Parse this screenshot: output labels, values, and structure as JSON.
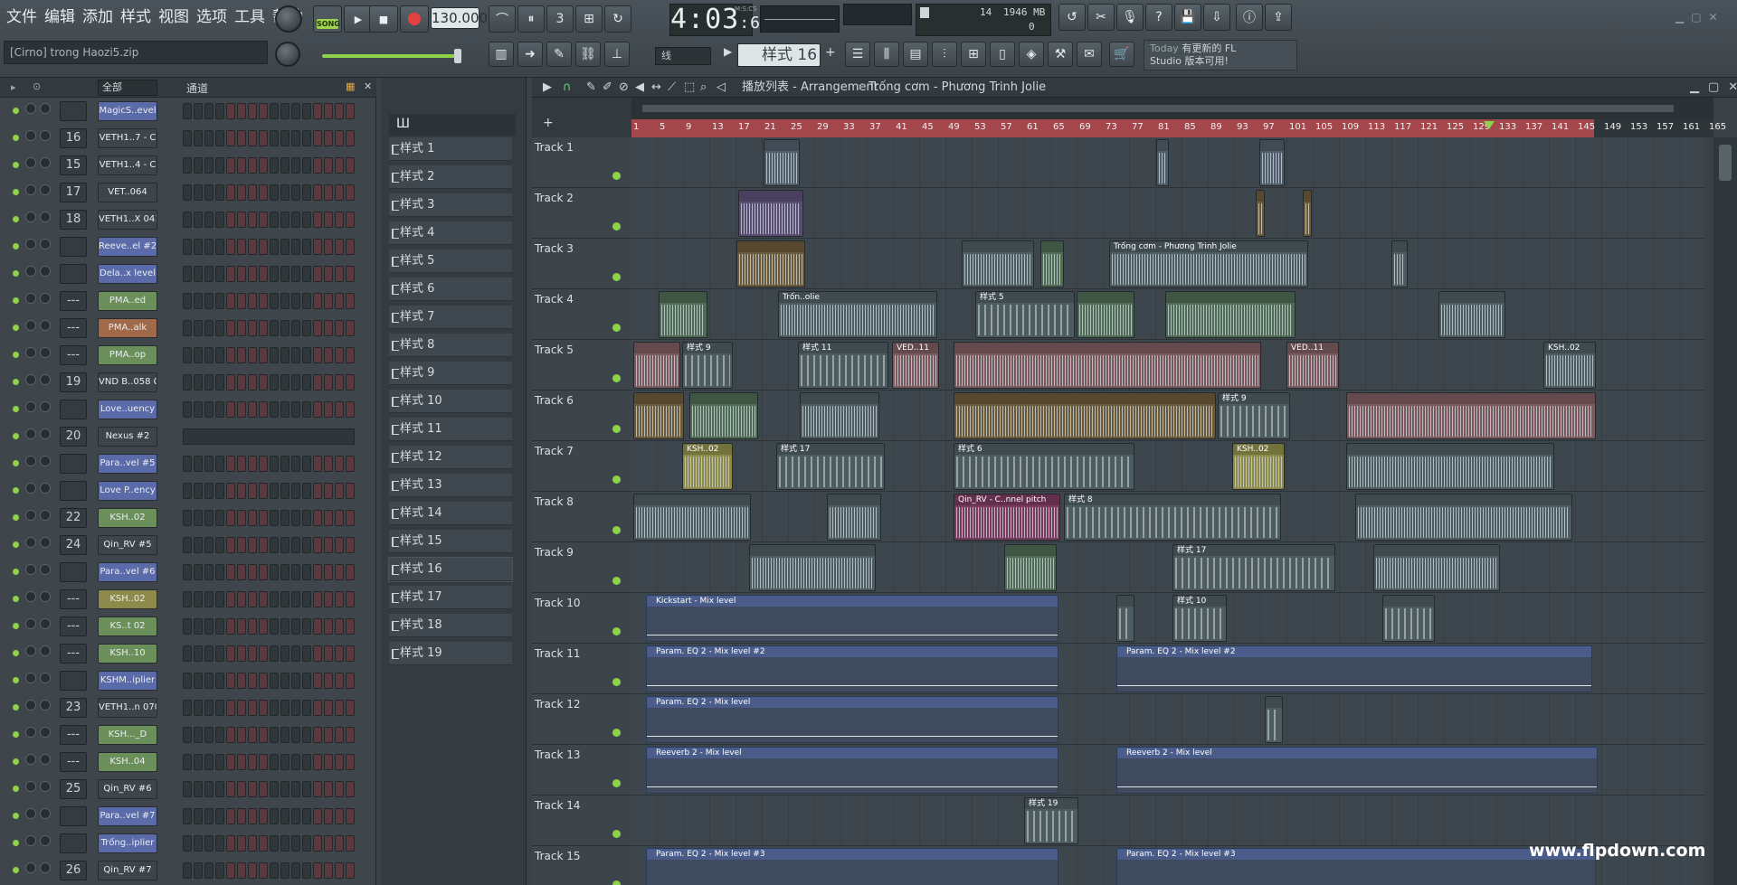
{
  "menu": [
    "文件",
    "编辑",
    "添加",
    "样式",
    "视图",
    "选项",
    "工具",
    "帮助"
  ],
  "hint_text": "[Cirno] trong Haozi5.zip",
  "song_label": "SONG",
  "tempo": "130.000",
  "clock": {
    "time": "4:03",
    "sub": ":69",
    "unit": "M:S:CS"
  },
  "cpu": {
    "value": "14",
    "memory": "1946 MB",
    "voices": "0"
  },
  "snap": "线",
  "pattern_selector": "样式 16",
  "news": {
    "day": "Today",
    "line1": "有更新的 FL",
    "line2": "Studio 版本可用!"
  },
  "rack": {
    "filter": "全部",
    "group": "通道"
  },
  "channels": [
    {
      "num": "",
      "name": "MagicS..evel",
      "color": "#5b6aa8"
    },
    {
      "num": "16",
      "name": "VETH1..7 - C",
      "color": "#3d454b"
    },
    {
      "num": "15",
      "name": "VETH1..4 - C",
      "color": "#3d454b"
    },
    {
      "num": "17",
      "name": "VET..064",
      "color": "#3d454b"
    },
    {
      "num": "18",
      "name": "VETH1..X 041",
      "color": "#3d454b"
    },
    {
      "num": "",
      "name": "Reeve..el #2",
      "color": "#5b6aa8"
    },
    {
      "num": "",
      "name": "Dela..x level",
      "color": "#5b6aa8"
    },
    {
      "num": "---",
      "name": "PMA..ed",
      "color": "#6a8f5a"
    },
    {
      "num": "---",
      "name": "PMA..alk",
      "color": "#a06a4a"
    },
    {
      "num": "---",
      "name": "PMA..op",
      "color": "#6a8f5a"
    },
    {
      "num": "19",
      "name": "VND B..058 C",
      "color": "#3d454b"
    },
    {
      "num": "",
      "name": "Love..uency",
      "color": "#5b6aa8"
    },
    {
      "num": "20",
      "name": "Nexus #2",
      "color": "#3d454b"
    },
    {
      "num": "",
      "name": "Para..vel #5",
      "color": "#5b6aa8"
    },
    {
      "num": "",
      "name": "Love P..ency",
      "color": "#5b6aa8"
    },
    {
      "num": "22",
      "name": "KSH..02",
      "color": "#6a8f5a"
    },
    {
      "num": "24",
      "name": "Qin_RV #5",
      "color": "#3d454b"
    },
    {
      "num": "",
      "name": "Para..vel #6",
      "color": "#5b6aa8"
    },
    {
      "num": "---",
      "name": "KSH..02",
      "color": "#8d8a4a"
    },
    {
      "num": "---",
      "name": "KS..t 02",
      "color": "#6a8f5a"
    },
    {
      "num": "---",
      "name": "KSH..10",
      "color": "#6a8f5a"
    },
    {
      "num": "",
      "name": "KSHM..iplier",
      "color": "#5b6aa8"
    },
    {
      "num": "23",
      "name": "VETH1..n 070",
      "color": "#3d454b"
    },
    {
      "num": "---",
      "name": "KSH..._D",
      "color": "#6a8f5a"
    },
    {
      "num": "---",
      "name": "KSH..04",
      "color": "#6a8f5a"
    },
    {
      "num": "25",
      "name": "Qin_RV #6",
      "color": "#3d454b"
    },
    {
      "num": "",
      "name": "Para..vel #7",
      "color": "#5b6aa8"
    },
    {
      "num": "",
      "name": "Trống..iplier",
      "color": "#5b6aa8"
    },
    {
      "num": "26",
      "name": "Qin_RV #7",
      "color": "#3d454b"
    }
  ],
  "patterns": [
    "样式 1",
    "样式 2",
    "样式 3",
    "样式 4",
    "样式 5",
    "样式 6",
    "样式 7",
    "样式 8",
    "样式 9",
    "样式 10",
    "样式 11",
    "样式 12",
    "样式 13",
    "样式 14",
    "样式 15",
    "样式 16",
    "样式 17",
    "样式 18",
    "样式 19"
  ],
  "playlist": {
    "title": "播放列表 - Arrangement",
    "crumb": "Trống cơm - Phương Trinh Jolie",
    "ruler": [
      "1",
      "5",
      "9",
      "13",
      "17",
      "21",
      "25",
      "29",
      "33",
      "37",
      "41",
      "45",
      "49",
      "53",
      "57",
      "61",
      "65",
      "69",
      "73",
      "77",
      "81",
      "85",
      "89",
      "93",
      "97",
      "101",
      "105",
      "109",
      "113",
      "117",
      "121",
      "125",
      "129",
      "133",
      "137",
      "141",
      "145",
      "149",
      "153",
      "157",
      "161",
      "165"
    ],
    "tracks": [
      "Track 1",
      "Track 2",
      "Track 3",
      "Track 4",
      "Track 5",
      "Track 6",
      "Track 7",
      "Track 8",
      "Track 9",
      "Track 10",
      "Track 11",
      "Track 12",
      "Track 13",
      "Track 14",
      "Track 15"
    ],
    "clip_labels": {
      "t3": "Trống cơm - Phương Trinh Jolie",
      "t4": "Trốn..olie",
      "p5": "样式 5",
      "p9": "样式 9",
      "p11": "样式 11",
      "ved": "VED..11",
      "ksh02": "KSH..02",
      "p17": "样式 17",
      "p6": "样式 6",
      "p8": "样式 8",
      "qin": "Qin_RV - C..nnel pitch",
      "p10": "样式 10",
      "kick": "Kickstart - Mix level",
      "eq2": "Param. EQ 2 - Mix level #2",
      "eq1": "Param. EQ 2 - Mix level",
      "rev": "Reeverb 2 - Mix level",
      "p19": "样式 19",
      "eq3": "Param. EQ 2 - Mix level #3"
    }
  },
  "watermark": "www.flpdown.com"
}
